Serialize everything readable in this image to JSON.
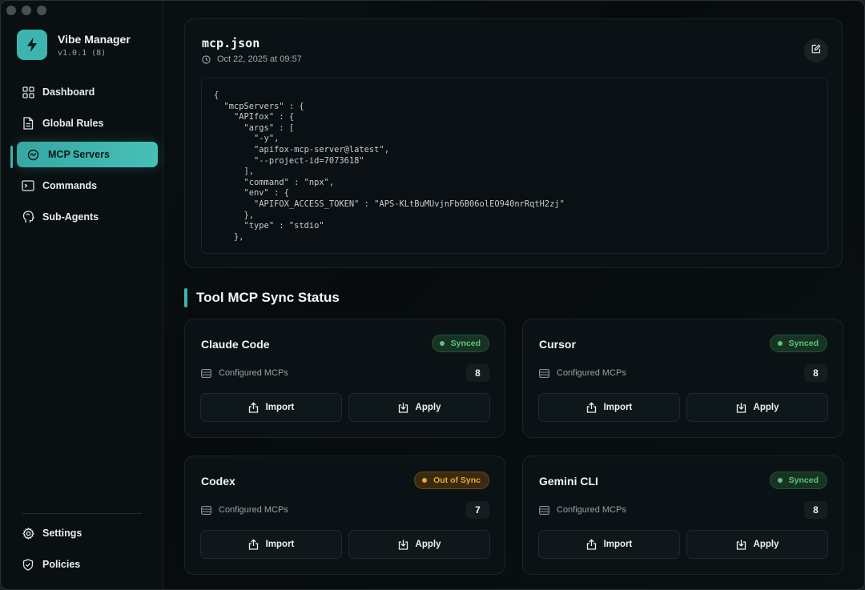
{
  "app": {
    "name": "Vibe Manager",
    "version": "v1.0.1 (8)"
  },
  "sidebar": {
    "items": [
      {
        "label": "Dashboard",
        "icon": "dashboard-icon"
      },
      {
        "label": "Global Rules",
        "icon": "document-icon"
      },
      {
        "label": "MCP Servers",
        "icon": "mcp-icon",
        "active": true
      },
      {
        "label": "Commands",
        "icon": "terminal-icon"
      },
      {
        "label": "Sub-Agents",
        "icon": "head-icon"
      }
    ],
    "bottom": [
      {
        "label": "Settings",
        "icon": "gear-icon"
      },
      {
        "label": "Policies",
        "icon": "shield-icon"
      }
    ]
  },
  "file": {
    "name": "mcp.json",
    "modified": "Oct 22, 2025 at 09:57",
    "content": "{\n  \"mcpServers\" : {\n    \"APIfox\" : {\n      \"args\" : [\n        \"-y\",\n        \"apifox-mcp-server@latest\",\n        \"--project-id=7073618\"\n      ],\n      \"command\" : \"npx\",\n      \"env\" : {\n        \"APIFOX_ACCESS_TOKEN\" : \"APS-KLtBuMUvjnFb6B06olEO940nrRqtH2zj\"\n      },\n      \"type\" : \"stdio\"\n    },"
  },
  "sync": {
    "title": "Tool MCP Sync Status",
    "configured_label": "Configured MCPs",
    "import_label": "Import",
    "apply_label": "Apply",
    "tools": [
      {
        "name": "Claude Code",
        "status": "Synced",
        "state": "synced",
        "count": "8"
      },
      {
        "name": "Cursor",
        "status": "Synced",
        "state": "synced",
        "count": "8"
      },
      {
        "name": "Codex",
        "status": "Out of Sync",
        "state": "out",
        "count": "7"
      },
      {
        "name": "Gemini CLI",
        "status": "Synced",
        "state": "synced",
        "count": "8"
      }
    ]
  },
  "colors": {
    "accent": "#3fb4ae",
    "synced": "#5fc381",
    "out_of_sync": "#e7a83a"
  }
}
